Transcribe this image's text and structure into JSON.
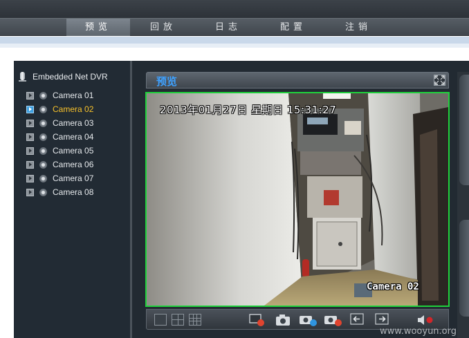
{
  "nav": {
    "items": [
      {
        "label": "预览",
        "active": true
      },
      {
        "label": "回放",
        "active": false
      },
      {
        "label": "日志",
        "active": false
      },
      {
        "label": "配置",
        "active": false
      },
      {
        "label": "注销",
        "active": false
      }
    ]
  },
  "tree": {
    "root_label": "Embedded Net DVR",
    "root_icon": "dvr-device-icon",
    "cameras": [
      {
        "label": "Camera 01",
        "selected": false
      },
      {
        "label": "Camera 02",
        "selected": true
      },
      {
        "label": "Camera 03",
        "selected": false
      },
      {
        "label": "Camera 04",
        "selected": false
      },
      {
        "label": "Camera 05",
        "selected": false
      },
      {
        "label": "Camera 06",
        "selected": false
      },
      {
        "label": "Camera 07",
        "selected": false
      },
      {
        "label": "Camera 08",
        "selected": false
      }
    ],
    "selected_color": "#f7c12a"
  },
  "preview": {
    "title": "预览",
    "title_color": "#3ea1ff",
    "fullscreen_icon": "fullscreen-icon",
    "video_border_color": "#1fd23c",
    "osd_timestamp": "2013年01月27日  星期日  15:31:27",
    "osd_camera": "Camera 02"
  },
  "toolbar": {
    "icons": [
      "single-view-icon",
      "quad-view-icon",
      "nine-view-icon",
      "record-icon",
      "snapshot-icon",
      "start-all-preview-icon",
      "stop-all-preview-icon",
      "previous-page-icon",
      "next-page-icon",
      "volume-icon"
    ]
  },
  "watermark": "www.wooyun.org"
}
